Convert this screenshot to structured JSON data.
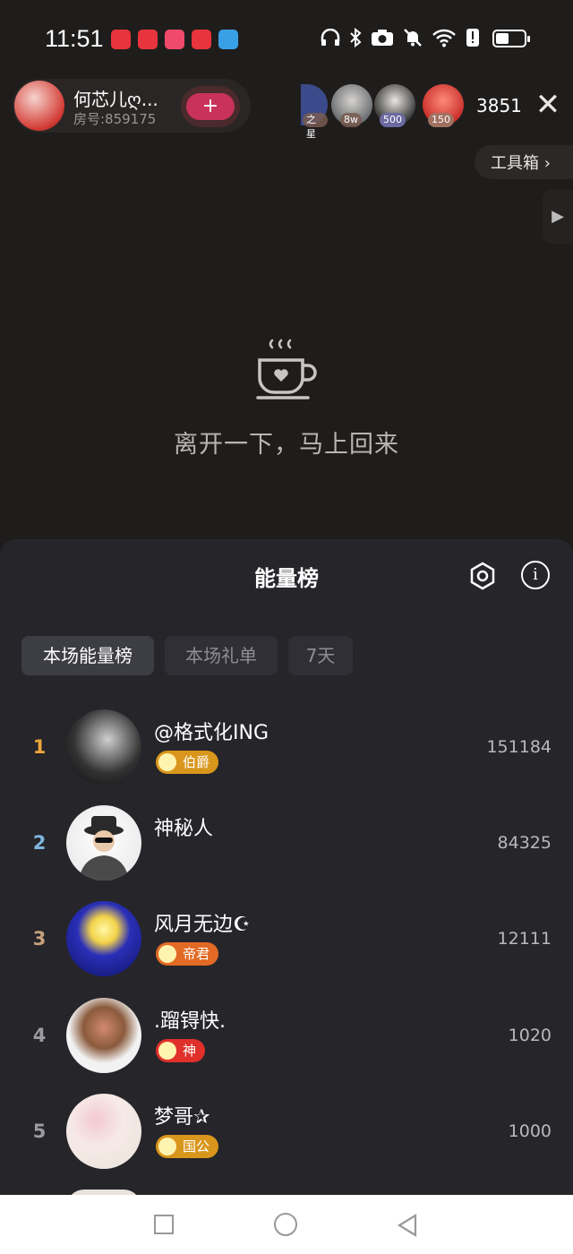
{
  "status_bar": {
    "time": "11:51",
    "battery_level": 0.45,
    "app_icons": [
      "huawei-app-icon",
      "huawei-app-icon",
      "red-character-app-icon",
      "huawei-app-icon",
      "blue-app-icon"
    ],
    "icons": [
      "headphones-icon",
      "bluetooth-icon",
      "camera-icon",
      "mute-icon",
      "wifi-icon",
      "alert-icon",
      "battery-icon"
    ]
  },
  "room": {
    "name": "何芯儿ღ...",
    "room_id": "房号:859175",
    "viewer_count": "3851",
    "viewers": [
      {
        "badge": "之星",
        "color": "#3b4a8a"
      },
      {
        "badge": "8w",
        "color": "#6b6f73"
      },
      {
        "badge": "500",
        "color": "#3a3a3a"
      },
      {
        "badge": "150",
        "color": "#c9302c"
      }
    ]
  },
  "toolbox_label": "工具箱 ›",
  "away_message": "离开一下，马上回来",
  "panel": {
    "title": "能量榜",
    "tabs": [
      "本场能量榜",
      "本场礼单",
      "7天"
    ]
  },
  "leaderboard": [
    {
      "rank": "1",
      "name": "@格式化ING",
      "badge": "伯爵",
      "score": "151184",
      "rank_color": "#f0a53b",
      "badge_color": "#d9961c"
    },
    {
      "rank": "2",
      "name": "神秘人",
      "badge": "",
      "score": "84325",
      "rank_color": "#7fb6de",
      "badge_color": ""
    },
    {
      "rank": "3",
      "name": "风月无边☪",
      "badge": "帝君",
      "score": "12111",
      "rank_color": "#c7a27e",
      "badge_color": "#e26a24"
    },
    {
      "rank": "4",
      "name": ".蹓锝快.",
      "badge": "神",
      "score": "1020",
      "rank_color": "#9a9aa0",
      "badge_color": "#e0302a"
    },
    {
      "rank": "5",
      "name": "梦哥✰",
      "badge": "国公",
      "score": "1000",
      "rank_color": "#9a9aa0",
      "badge_color": "#d9961c"
    }
  ],
  "colors": {
    "background": "#1f1d1c",
    "panel": "#25252a",
    "accent_heart": "#c9325a"
  }
}
